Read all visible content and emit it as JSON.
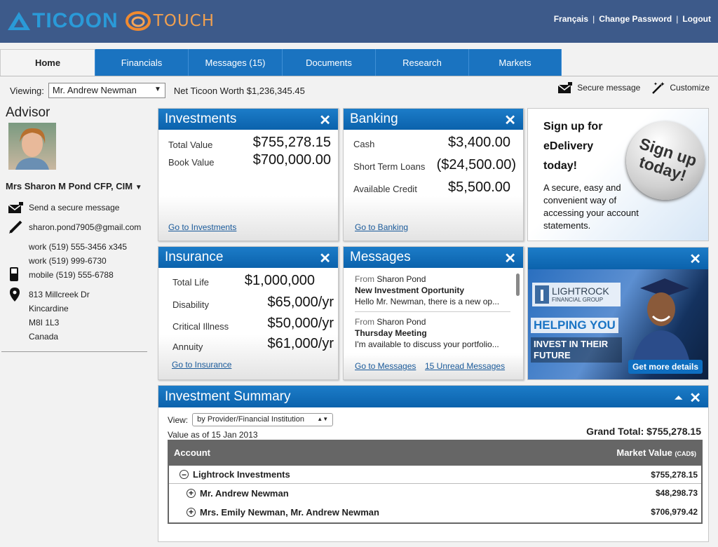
{
  "header": {
    "brand_main": "TICOON",
    "brand_sub": "TOUCH",
    "links": [
      "Français",
      "Change Password",
      "Logout"
    ]
  },
  "tabs": [
    {
      "label": "Home",
      "active": true
    },
    {
      "label": "Financials"
    },
    {
      "label": "Messages (15)"
    },
    {
      "label": "Documents"
    },
    {
      "label": "Research"
    },
    {
      "label": "Markets"
    }
  ],
  "viewing": {
    "label": "Viewing:",
    "selected": "Mr. Andrew Newman",
    "net_worth": "Net Ticoon Worth $1,236,345.45"
  },
  "actions": {
    "secure_message": "Secure message",
    "customize": "Customize"
  },
  "advisor": {
    "title": "Advisor",
    "name": "Mrs Sharon M Pond CFP, CIM",
    "send_message": "Send a secure message",
    "email": "sharon.pond7905@gmail.com",
    "phones": [
      "work (519) 555-3456 x345",
      "work (519) 999-6730",
      "mobile (519) 555-6788"
    ],
    "address": [
      "813 Millcreek Dr",
      "Kincardine",
      "M8I 1L3",
      "Canada"
    ]
  },
  "investments": {
    "title": "Investments",
    "rows": [
      {
        "label": "Total Value",
        "value": "$755,278.15"
      },
      {
        "label": "Book Value",
        "value": "$700,000.00"
      }
    ],
    "link": "Go to Investments"
  },
  "banking": {
    "title": "Banking",
    "rows": [
      {
        "label": "Cash",
        "value": "$3,400.00"
      },
      {
        "label": "Short Term Loans",
        "value": "($24,500.00)"
      },
      {
        "label": "Available Credit",
        "value": "$5,500.00"
      }
    ],
    "link": "Go to Banking"
  },
  "insurance": {
    "title": "Insurance",
    "rows": [
      {
        "label": "Total Life",
        "value": "$1,000,000"
      },
      {
        "label": "Disability",
        "value": "$65,000/yr"
      },
      {
        "label": "Critical Illness",
        "value": "$50,000/yr"
      },
      {
        "label": "Annuity",
        "value": "$61,000/yr"
      }
    ],
    "link": "Go to Insurance"
  },
  "messages": {
    "title": "Messages",
    "items": [
      {
        "from_label": "From",
        "from": "Sharon Pond",
        "subject": "New Investment Oportunity",
        "preview": "Hello Mr. Newman, there is a new op..."
      },
      {
        "from_label": "From",
        "from": "Sharon Pond",
        "subject": "Thursday Meeting",
        "preview": "I'm available to discuss your portfolio..."
      }
    ],
    "link": "Go to Messages",
    "unread_link": "15 Unread Messages"
  },
  "promo_edelivery": {
    "title_lines": [
      "Sign up for",
      "eDelivery",
      "today!"
    ],
    "badge": "Sign up today!",
    "description": "A secure, easy and convenient way of accessing your account statements."
  },
  "promo_lightrock": {
    "brand": "LIGHTROCK",
    "brand_sub": "FINANCIAL GROUP",
    "headline": "HELPING YOU",
    "subhead": "INVEST IN THEIR FUTURE",
    "button": "Get more details"
  },
  "summary": {
    "title": "Investment Summary",
    "view_label": "View:",
    "view_selected": "by Provider/Financial Institution",
    "as_of": "Value as of 15 Jan 2013",
    "grand_total": "Grand Total: $755,278.15",
    "col_account": "Account",
    "col_value": "Market Value",
    "col_value_unit": "(CAD$)",
    "rows": [
      {
        "label": "Lightrock Investments",
        "value": "$755,278.15",
        "toggle": "−"
      },
      {
        "label": "Mr. Andrew Newman",
        "value": "$48,298.73",
        "toggle": "+"
      },
      {
        "label": "Mrs. Emily Newman, Mr. Andrew Newman",
        "value": "$706,979.42",
        "toggle": "+"
      }
    ]
  },
  "colors": {
    "header_bg": "#3d5a8a",
    "tab_blue": "#1a73c0",
    "widget_header": "#0b62ac",
    "link": "#1a5a9a"
  }
}
